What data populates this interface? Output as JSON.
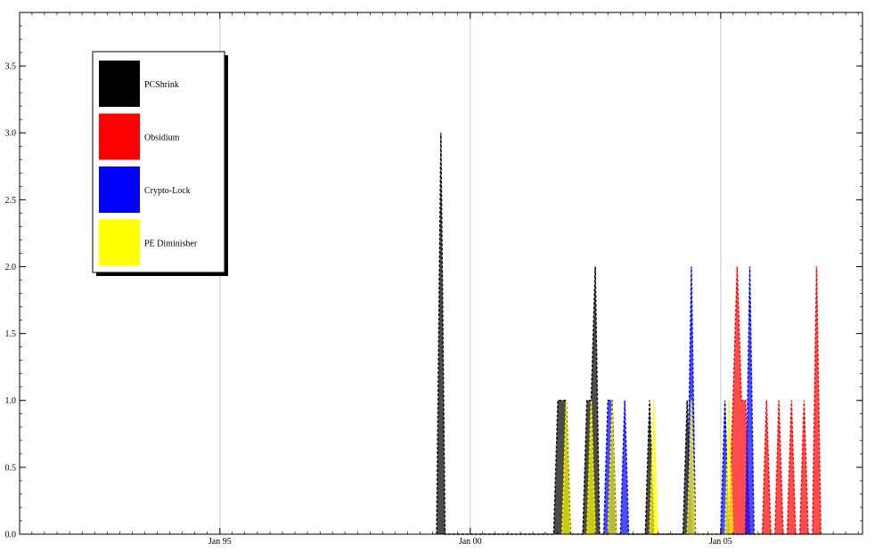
{
  "chart_data": {
    "type": "area",
    "title": "",
    "xlabel": "",
    "ylabel": "",
    "xlim": [
      "1991-01-01",
      "2007-11-01"
    ],
    "ylim": [
      0,
      3.9
    ],
    "grid": "vertical lines at x ticks",
    "legend_placement": "top-left",
    "x_ticks": [
      {
        "date": "1995-01-01",
        "label": "Jan 95"
      },
      {
        "date": "2000-01-01",
        "label": "Jan 00"
      },
      {
        "date": "2005-01-01",
        "label": "Jan 05"
      }
    ],
    "y_ticks": [
      {
        "value": 0,
        "label": "0.0"
      },
      {
        "value": 0.5,
        "label": "0.5"
      },
      {
        "value": 1.0,
        "label": "1.0"
      },
      {
        "value": 1.5,
        "label": "1.5"
      },
      {
        "value": 2.0,
        "label": "2.0"
      },
      {
        "value": 2.5,
        "label": "2.5"
      },
      {
        "value": 3.0,
        "label": "3.0"
      },
      {
        "value": 3.5,
        "label": "3.5"
      }
    ],
    "series": [
      {
        "name": "PCShrink",
        "color": "#000000",
        "points": [
          [
            "1999-05-01",
            0
          ],
          [
            "1999-06-01",
            3
          ],
          [
            "1999-07-01",
            0
          ],
          [
            "2001-09-01",
            0
          ],
          [
            "2001-10-01",
            1
          ],
          [
            "2001-11-01",
            1
          ],
          [
            "2001-12-01",
            1
          ],
          [
            "2002-01-01",
            0
          ],
          [
            "2002-04-01",
            0
          ],
          [
            "2002-05-01",
            1
          ],
          [
            "2002-06-01",
            1
          ],
          [
            "2002-07-01",
            2
          ],
          [
            "2002-08-01",
            0
          ],
          [
            "2002-10-01",
            0
          ],
          [
            "2002-11-01",
            1
          ],
          [
            "2002-12-01",
            0
          ],
          [
            "2003-07-01",
            0
          ],
          [
            "2003-08-01",
            1
          ],
          [
            "2003-09-01",
            0
          ],
          [
            "2004-04-01",
            0
          ],
          [
            "2004-05-01",
            1
          ],
          [
            "2004-06-01",
            0
          ]
        ]
      },
      {
        "name": "Obsidium",
        "color": "#ff0000",
        "points": [
          [
            "2005-03-01",
            0
          ],
          [
            "2005-04-01",
            1
          ],
          [
            "2005-05-01",
            2
          ],
          [
            "2005-06-01",
            1
          ],
          [
            "2005-07-01",
            1
          ],
          [
            "2005-08-01",
            0
          ],
          [
            "2005-11-01",
            0
          ],
          [
            "2005-12-01",
            1
          ],
          [
            "2006-01-01",
            0
          ],
          [
            "2006-02-01",
            0
          ],
          [
            "2006-03-01",
            1
          ],
          [
            "2006-04-01",
            0
          ],
          [
            "2006-05-01",
            0
          ],
          [
            "2006-06-01",
            1
          ],
          [
            "2006-07-01",
            0
          ],
          [
            "2006-08-01",
            0
          ],
          [
            "2006-09-01",
            1
          ],
          [
            "2006-10-01",
            0
          ],
          [
            "2006-11-01",
            0
          ],
          [
            "2006-12-01",
            2
          ],
          [
            "2007-01-01",
            0
          ]
        ]
      },
      {
        "name": "Crypto-Lock",
        "color": "#0000ff",
        "points": [
          [
            "2002-09-01",
            0
          ],
          [
            "2002-10-01",
            1
          ],
          [
            "2002-11-01",
            1
          ],
          [
            "2002-12-01",
            0
          ],
          [
            "2003-01-01",
            0
          ],
          [
            "2003-02-01",
            1
          ],
          [
            "2003-03-01",
            0
          ],
          [
            "2004-05-01",
            0
          ],
          [
            "2004-06-01",
            2
          ],
          [
            "2004-07-01",
            0
          ],
          [
            "2005-01-01",
            0
          ],
          [
            "2005-02-01",
            1
          ],
          [
            "2005-03-01",
            0
          ],
          [
            "2005-07-01",
            0
          ],
          [
            "2005-08-01",
            2
          ],
          [
            "2005-09-01",
            0
          ]
        ]
      },
      {
        "name": "PE Diminisher",
        "color": "#ffff00",
        "points": [
          [
            "2001-11-01",
            0
          ],
          [
            "2001-12-01",
            1
          ],
          [
            "2002-01-01",
            0
          ],
          [
            "2002-05-01",
            0
          ],
          [
            "2002-06-01",
            1
          ],
          [
            "2002-07-01",
            0
          ],
          [
            "2002-10-01",
            0
          ],
          [
            "2002-11-01",
            1
          ],
          [
            "2002-12-01",
            0
          ],
          [
            "2003-08-01",
            0
          ],
          [
            "2003-09-01",
            1
          ],
          [
            "2003-10-01",
            0
          ],
          [
            "2004-05-01",
            0
          ],
          [
            "2004-06-01",
            1
          ],
          [
            "2004-07-01",
            0
          ],
          [
            "2005-02-01",
            0
          ],
          [
            "2005-03-01",
            1
          ],
          [
            "2005-04-01",
            0
          ]
        ]
      }
    ]
  }
}
